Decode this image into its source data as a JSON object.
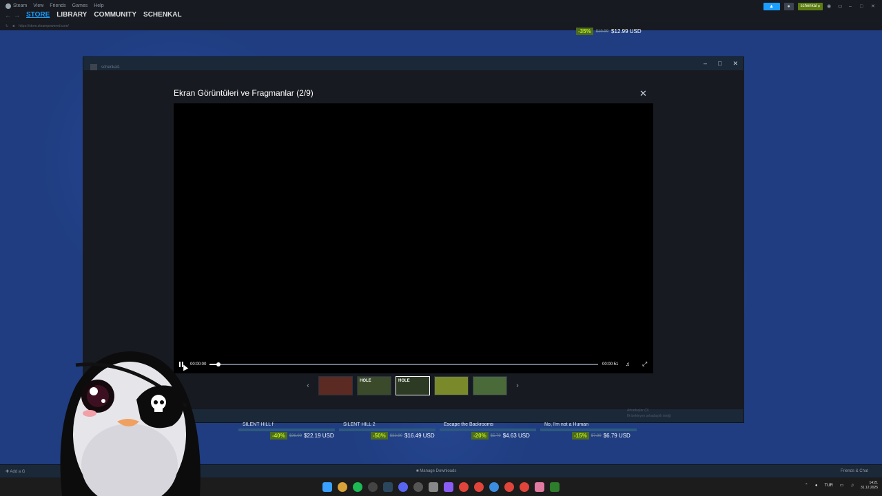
{
  "menubar": {
    "app": "Steam",
    "items": [
      "View",
      "Friends",
      "Games",
      "Help"
    ]
  },
  "nav": {
    "tabs": [
      "STORE",
      "LIBRARY",
      "COMMUNITY",
      "SCHENKAL"
    ],
    "active_tab": "STORE",
    "url": "https://store.steampowered.com/"
  },
  "topright": {
    "username": "schenkal"
  },
  "store_top_sale": {
    "discount": "-35%",
    "old_price": "$19.99",
    "price": "$12.99 USD"
  },
  "window": {
    "username": "schenkal1"
  },
  "modal": {
    "title": "Ekran Görüntüleri ve Fragmanlar (2/9)",
    "time_current": "00:00:00",
    "time_total": "00:00:51",
    "progress": 0.023,
    "thumbnails": [
      {
        "label": "",
        "color": "#5b2a22"
      },
      {
        "label": "HOLE",
        "color": "#3b4a2a"
      },
      {
        "label": "HOLE",
        "color": "#2d3a24",
        "selected": true
      },
      {
        "label": "",
        "color": "#7a8a2a"
      },
      {
        "label": "",
        "color": "#4a6a3a"
      }
    ]
  },
  "friends_panel": {
    "line1": "Arkadaşlar (0)",
    "line2": "İlk bekleyen arkadaşlık isteği"
  },
  "games": [
    {
      "name": "SILENT HILL f",
      "discount": "-40%",
      "old_price": "$36.99",
      "price": "$22.19 USD"
    },
    {
      "name": "SILENT HILL 2",
      "discount": "-50%",
      "old_price": "$32.99",
      "price": "$16.49 USD"
    },
    {
      "name": "Escape the Backrooms",
      "discount": "-20%",
      "old_price": "$5.79",
      "price": "$4.63 USD"
    },
    {
      "name": "No, I'm not a Human",
      "discount": "-15%",
      "old_price": "$7.99",
      "price": "$6.79 USD"
    }
  ],
  "bottombar": {
    "add_game": "Add a G",
    "downloads": "Manage Downloads",
    "friends": "Friends & Chat"
  },
  "taskbar": {
    "lang": "TUR",
    "time": "14:21",
    "date": "31.12.2025"
  },
  "colors": {
    "accent": "#1a9fff",
    "discount_bg": "#4c6b22",
    "discount_fg": "#beee11"
  }
}
